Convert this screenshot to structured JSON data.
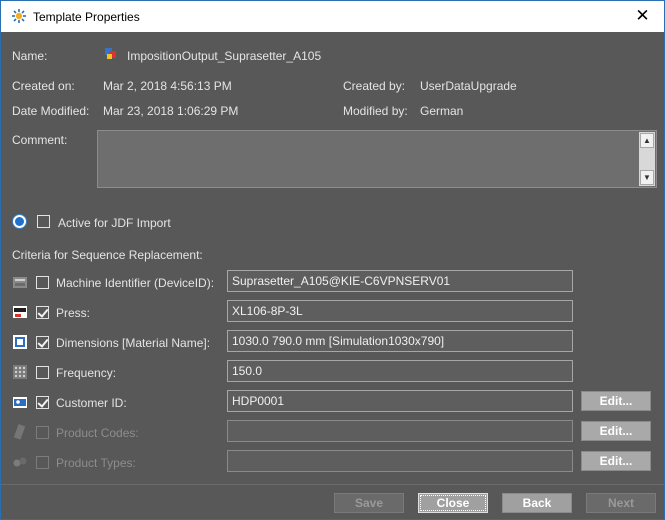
{
  "window": {
    "title": "Template Properties",
    "close_glyph": "✕"
  },
  "info": {
    "name_label": "Name:",
    "name_value": "ImpositionOutput_Suprasetter_A105",
    "created_on_label": "Created on:",
    "created_on_value": "Mar 2, 2018 4:56:13 PM",
    "created_by_label": "Created by:",
    "created_by_value": "UserDataUpgrade",
    "modified_label": "Date Modified:",
    "modified_value": "Mar 23, 2018 1:06:29 PM",
    "modified_by_label": "Modified by:",
    "modified_by_value": "German",
    "comment_label": "Comment:",
    "comment_value": ""
  },
  "jdf": {
    "label": "Active for JDF Import",
    "checked": false
  },
  "criteria": {
    "heading": "Criteria for Sequence Replacement:",
    "edit_label": "Edit...",
    "rows": [
      {
        "label": "Machine Identifier (DeviceID):",
        "value": "Suprasetter_A105@KIE-C6VPNSERV01",
        "checked": false,
        "enabled": true,
        "icon": "machine-icon"
      },
      {
        "label": "Press:",
        "value": "XL106-8P-3L",
        "checked": true,
        "enabled": true,
        "icon": "press-icon"
      },
      {
        "label": "Dimensions [Material Name]:",
        "value": "1030.0 790.0 mm [Simulation1030x790]",
        "checked": true,
        "enabled": true,
        "icon": "dimensions-icon"
      },
      {
        "label": "Frequency:",
        "value": "150.0",
        "checked": false,
        "enabled": true,
        "icon": "frequency-icon"
      },
      {
        "label": "Customer ID:",
        "value": "HDP0001",
        "checked": true,
        "enabled": true,
        "icon": "customer-icon"
      },
      {
        "label": "Product Codes:",
        "value": "",
        "checked": false,
        "enabled": false,
        "icon": "product-codes-icon"
      },
      {
        "label": "Product Types:",
        "value": "",
        "checked": false,
        "enabled": false,
        "icon": "product-types-icon"
      }
    ]
  },
  "footer": {
    "save": "Save",
    "close": "Close",
    "back": "Back",
    "next": "Next"
  }
}
